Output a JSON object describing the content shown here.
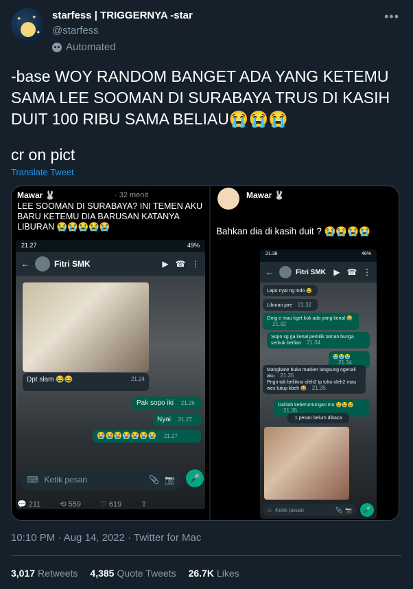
{
  "header": {
    "name": "starfess | TRIGGERNYA -star",
    "handle": "@starfess",
    "automated": "Automated"
  },
  "tweet": {
    "text": "-base WOY RANDOM BANGET ADA YANG KETEMU SAMA LEE SOOMAN DI SURABAYA TRUS DI KASIH DUIT 100 RIBU SAMA BELIAU😭😭😭",
    "cr": "cr on pict",
    "translate": "Translate Tweet"
  },
  "left_shot": {
    "user": "Mawar 🐰",
    "time": "· 32 menit",
    "text": "LEE SOOMAN DI SURABAYA? INI TEMEN AKU BARU KETEMU DIA BARUSAN KATANYA LIBURAN 😭😭😭😭😭",
    "status_time": "21.27",
    "battery": "49%",
    "contact": "Fitri SMK",
    "msg_in": "Dpt slam 😂😂",
    "msg_in_ts": "21.24",
    "msg_out1": "Pak sopo iki",
    "msg_out1_ts": "21.26",
    "msg_out2": "Nyai",
    "msg_out2_ts": "21.27",
    "msg_out3": "😭😭😭😭😭😭😭",
    "msg_out3_ts": "21.27",
    "input_placeholder": "Ketik pesan",
    "replies": "211",
    "retweets": "559",
    "likes": "619"
  },
  "right_shot": {
    "user": "Mawar 🐰",
    "text": "Bahkan dia di kasih duit ? 😭😭😭😭",
    "status_time": "21.38",
    "battery": "46%",
    "contact": "Fitri SMK",
    "msgs": [
      {
        "side": "in",
        "text": "Lapo nyai ng indo 😂",
        "ts": ""
      },
      {
        "side": "in",
        "text": "Liburan jare",
        "ts": "21.32"
      },
      {
        "side": "out",
        "text": "Omg e mau kget kok ada yang kenal 😂",
        "ts": "21.32"
      },
      {
        "side": "out",
        "text": "Sopo sg ga kenal pemilik taman bunga serbuk berlian",
        "ts": "21.34"
      },
      {
        "side": "out",
        "text": "😭😭😭",
        "ts": "21.34"
      },
      {
        "side": "in",
        "text": "Mangkane buka masker langsung ngenali aku",
        "ts": "21.35"
      },
      {
        "side": "in",
        "text": "Pngn tak beliikno oleh2 tp toko oleh2 mau wes tutup kbeh 😂",
        "ts": "21.35"
      },
      {
        "side": "out",
        "text": "Dahlah keberuntungan mu 😭😭😭",
        "ts": "21.35"
      }
    ],
    "unread": "1 pesan belum dibaca",
    "input_placeholder": "Ketik pesan"
  },
  "meta": {
    "timestamp": "10:10 PM · Aug 14, 2022 · Twitter for Mac",
    "retweets_count": "3,017",
    "retweets_label": "Retweets",
    "quotes_count": "4,385",
    "quotes_label": "Quote Tweets",
    "likes_count": "26.7K",
    "likes_label": "Likes"
  },
  "colors": {
    "background": "#15202b",
    "accent": "#1d9bf0",
    "muted": "#8899a6",
    "wa_out": "#005c4b",
    "wa_in": "#1f2c34"
  }
}
